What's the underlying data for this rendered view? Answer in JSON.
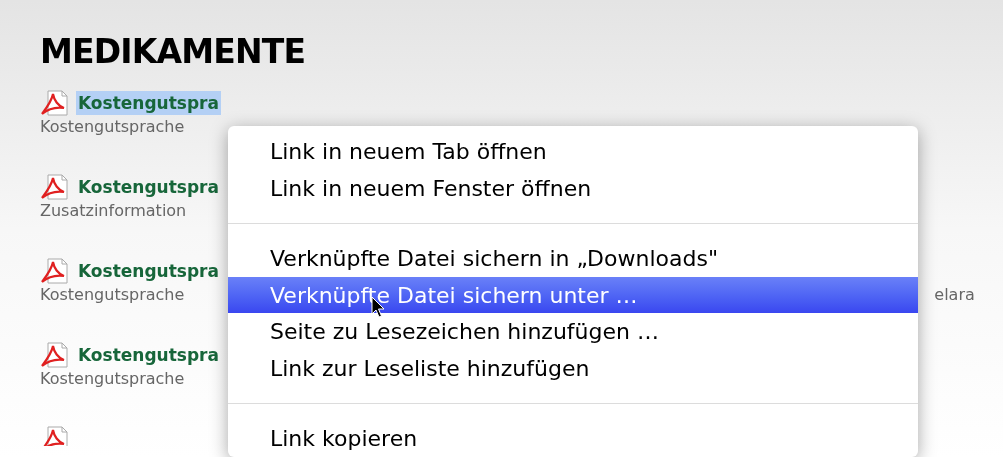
{
  "heading": "MEDIKAMENTE",
  "documents": [
    {
      "link": "Kostengutspra",
      "description": "Kostengutsprache",
      "selected": true
    },
    {
      "link": "Kostengutspra",
      "description": "Zusatzinformation",
      "selected": false
    },
    {
      "link": "Kostengutspra",
      "description": "Kostengutsprache",
      "description_tail": "elara",
      "selected": false
    },
    {
      "link": "Kostengutspra",
      "description": "Kostengutsprache",
      "selected": false
    },
    {
      "kind": "icon_only"
    }
  ],
  "context_menu": [
    {
      "kind": "item",
      "label": "Link in neuem Tab öffnen",
      "selected": false
    },
    {
      "kind": "item",
      "label": "Link in neuem Fenster öffnen",
      "selected": false
    },
    {
      "kind": "separator"
    },
    {
      "kind": "item",
      "label": "Verknüpfte Datei sichern in „Downloads\"",
      "selected": false
    },
    {
      "kind": "item",
      "label": "Verknüpfte Datei sichern unter …",
      "selected": true
    },
    {
      "kind": "item",
      "label": "Seite zu Lesezeichen hinzufügen …",
      "selected": false
    },
    {
      "kind": "item",
      "label": "Link zur Leseliste hinzufügen",
      "selected": false
    },
    {
      "kind": "separator"
    },
    {
      "kind": "item",
      "label": "Link kopieren",
      "selected": false
    }
  ]
}
